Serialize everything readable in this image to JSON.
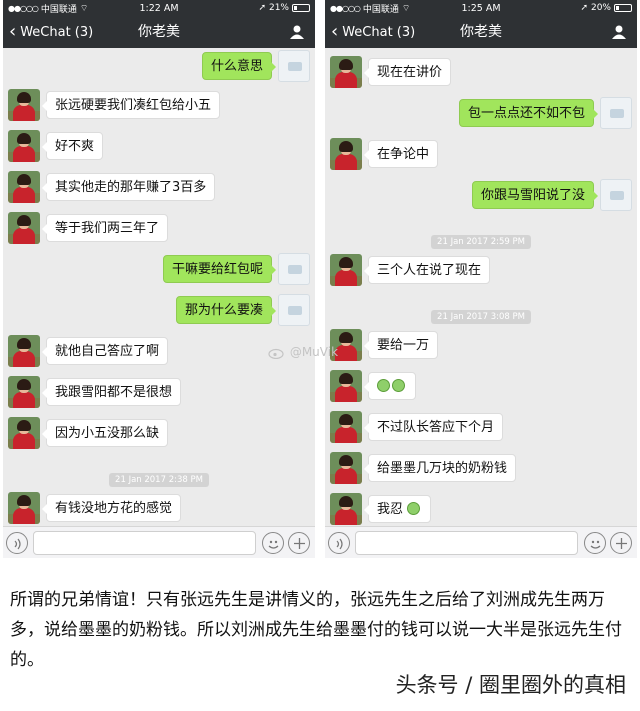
{
  "left_screen": {
    "status": {
      "carrier": "中国联通",
      "time": "1:22 AM",
      "battery": "21%"
    },
    "nav": {
      "back_label": "WeChat (3)",
      "title": "你老美"
    },
    "messages": [
      {
        "side": "out",
        "text": "什么意思"
      },
      {
        "side": "in",
        "text": "张远硬要我们凑红包给小五"
      },
      {
        "side": "in",
        "text": "好不爽"
      },
      {
        "side": "in",
        "text": "其实他走的那年赚了3百多"
      },
      {
        "side": "in",
        "text": "等于我们两三年了"
      },
      {
        "side": "out",
        "text": "干嘛要给红包呢"
      },
      {
        "side": "out",
        "text": "那为什么要凑"
      },
      {
        "side": "in",
        "text": "就他自己答应了啊"
      },
      {
        "side": "in",
        "text": "我跟雪阳都不是很想"
      },
      {
        "side": "in",
        "text": "因为小五没那么缺"
      },
      {
        "side": "in",
        "text": "有钱没地方花的感觉"
      }
    ],
    "timestamps": [
      "21 Jan 2017 2:38 PM"
    ]
  },
  "right_screen": {
    "status": {
      "carrier": "中国联通",
      "time": "1:25 AM",
      "battery": "20%"
    },
    "nav": {
      "back_label": "WeChat (3)",
      "title": "你老美"
    },
    "messages": [
      {
        "side": "in",
        "text": "现在在讲价"
      },
      {
        "side": "out",
        "text": "包一点点还不如不包"
      },
      {
        "side": "in",
        "text": "在争论中"
      },
      {
        "side": "out",
        "text": "你跟马雪阳说了没"
      },
      {
        "side": "in",
        "text": "三个人在说了现在"
      },
      {
        "side": "in",
        "text": "要给一万"
      },
      {
        "side": "in",
        "text": ""
      },
      {
        "side": "in",
        "text": "不过队长答应下个月"
      },
      {
        "side": "in",
        "text": "给墨墨几万块的奶粉钱"
      },
      {
        "side": "in",
        "text": "我忍"
      }
    ],
    "timestamps": [
      "21 Jan 2017 2:59 PM",
      "21 Jan 2017 3:08 PM"
    ]
  },
  "watermark": "@MuVik",
  "caption": "所谓的兄弟情谊！只有张远先生是讲情义的，张远先生之后给了刘洲成先生两万多，说给墨墨的奶粉钱。所以刘洲成先生给墨墨付的钱可以说一大半是张远先生付的。",
  "footer": "头条号 / 圈里圈外的真相",
  "colors": {
    "nav_bg": "#2e3134",
    "chat_bg": "#ebebeb",
    "bubble_out": "#a1e55c",
    "bubble_in": "#ffffff",
    "timestamp_bg": "#d3d3d3"
  }
}
